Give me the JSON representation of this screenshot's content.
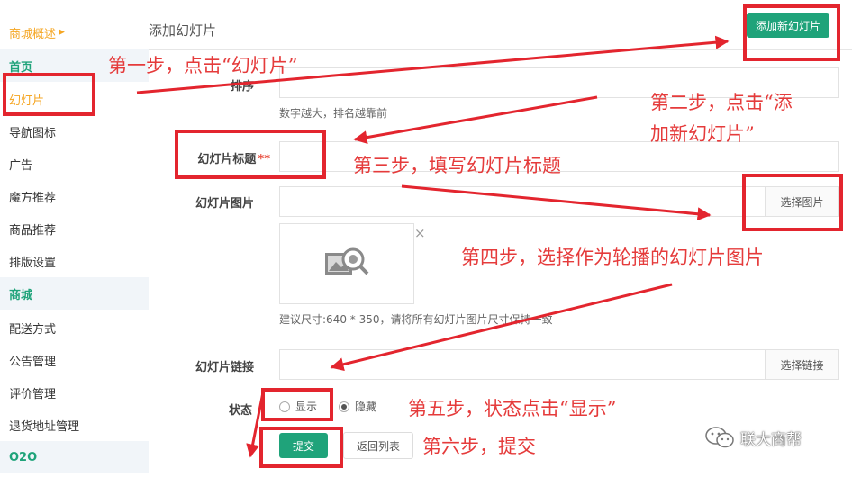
{
  "sidebar": {
    "overview": "商城概述",
    "items": [
      "首页",
      "幻灯片",
      "导航图标",
      "广告",
      "魔方推荐",
      "商品推荐",
      "排版设置",
      "商城",
      "配送方式",
      "公告管理",
      "评价管理",
      "退货地址管理",
      "O2O"
    ]
  },
  "header": {
    "title": "添加幻灯片",
    "add_button": "添加新幻灯片"
  },
  "form": {
    "sort_label": "排序",
    "sort_value": "",
    "sort_hint": "数字越大，排名越靠前",
    "title_label": "幻灯片标题",
    "required_mark": "**",
    "title_value": "",
    "image_label": "幻灯片图片",
    "image_value": "",
    "select_image": "选择图片",
    "image_close": "×",
    "image_hint": "建议尺寸:640 * 350，请将所有幻灯片图片尺寸保持一致",
    "link_label": "幻灯片链接",
    "link_value": "",
    "select_link": "选择链接",
    "status_label": "状态",
    "status_show": "显示",
    "status_hide": "隐藏",
    "submit": "提交",
    "back": "返回列表"
  },
  "annotations": {
    "step1": "第一步，点击“幻灯片”",
    "step2_line1": "第二步，点击“添",
    "step2_line2": "加新幻灯片”",
    "step3": "第三步，填写幻灯片标题",
    "step4": "第四步，选择作为轮播的幻灯片图片",
    "step5": "第五步，状态点击“显示”",
    "step6": "第六步，提交"
  },
  "watermark": "联大商帮",
  "colors": {
    "accent": "#1fa37a",
    "annotation": "#e53b3b",
    "highlight": "#f5a623"
  }
}
